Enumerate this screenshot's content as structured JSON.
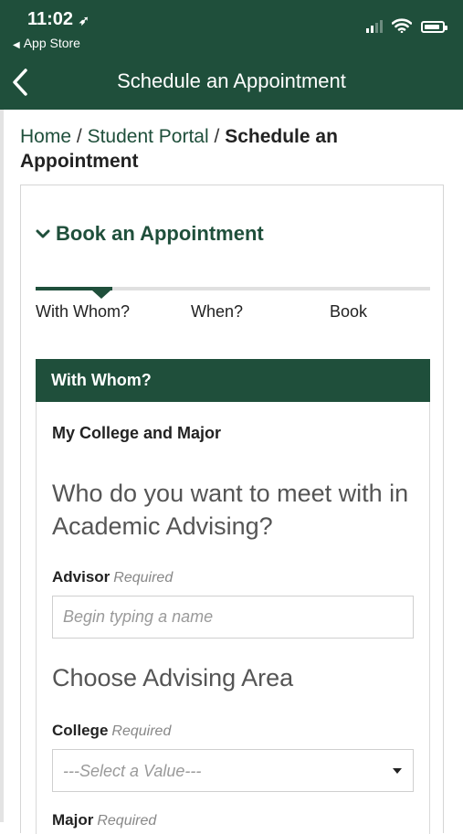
{
  "status_bar": {
    "time": "11:02",
    "location_icon": "location-arrow-icon",
    "back_app": "App Store"
  },
  "nav": {
    "title": "Schedule an Appointment",
    "back_icon": "chevron-left-icon"
  },
  "breadcrumb": {
    "items": [
      "Home",
      "Student Portal"
    ],
    "separator": "/",
    "current": "Schedule an Appointment"
  },
  "section": {
    "title": "Book an Appointment",
    "toggle_icon": "chevron-down-icon"
  },
  "steps": {
    "items": [
      "With Whom?",
      "When?",
      "Book"
    ],
    "active_index": 0
  },
  "panel": {
    "header": "With Whom?",
    "subheading": "My College and Major",
    "question": "Who do you want to meet with in Academic Advising?",
    "advisor": {
      "label": "Advisor",
      "required_text": "Required",
      "placeholder": "Begin typing a name"
    },
    "area_heading": "Choose Advising Area",
    "college": {
      "label": "College",
      "required_text": "Required",
      "selected": "---Select a Value---"
    },
    "major": {
      "label": "Major",
      "required_text": "Required"
    }
  },
  "colors": {
    "brand": "#1f4f3b",
    "track": "#e0e0e0"
  }
}
